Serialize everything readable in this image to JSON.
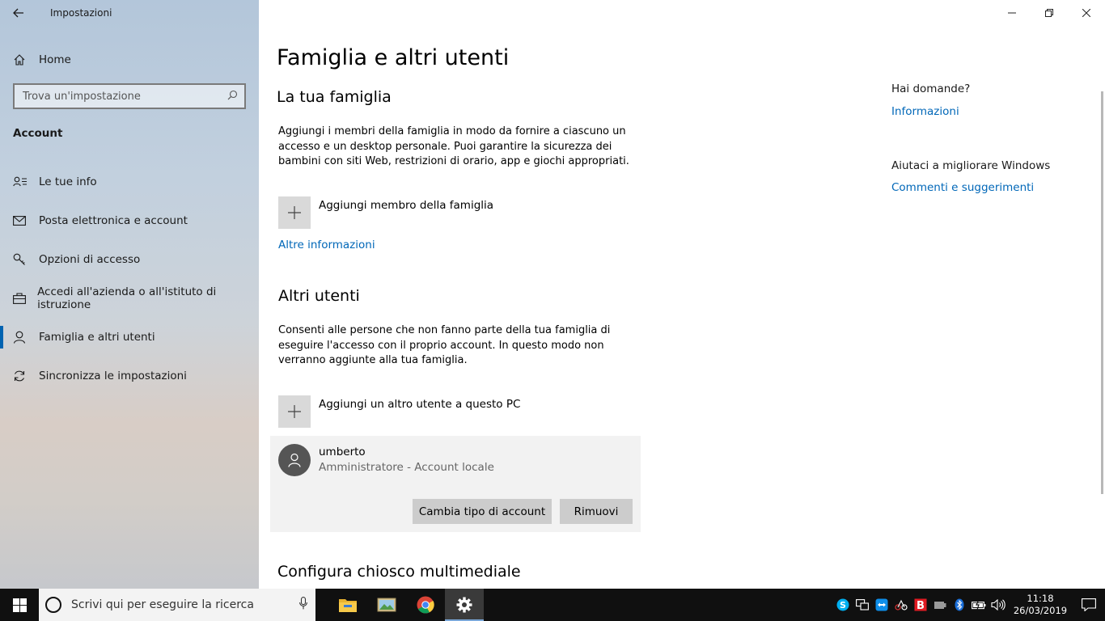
{
  "window": {
    "app_title": "Impostazioni",
    "controls": {
      "minimize": "—",
      "restore": "❐",
      "close": "✕"
    }
  },
  "sidebar": {
    "home_label": "Home",
    "search_placeholder": "Trova un'impostazione",
    "section": "Account",
    "items": [
      {
        "label": "Le tue info",
        "icon": "person-list-icon"
      },
      {
        "label": "Posta elettronica e account",
        "icon": "mail-icon"
      },
      {
        "label": "Opzioni di accesso",
        "icon": "key-icon"
      },
      {
        "label": "Accedi all'azienda o all'istituto di istruzione",
        "icon": "briefcase-icon"
      },
      {
        "label": "Famiglia e altri utenti",
        "icon": "person-icon",
        "active": true
      },
      {
        "label": "Sincronizza le impostazioni",
        "icon": "sync-icon"
      }
    ]
  },
  "main": {
    "title": "Famiglia e altri utenti",
    "family": {
      "heading": "La tua famiglia",
      "description": "Aggiungi i membri della famiglia in modo da fornire a ciascuno un accesso e un desktop personale. Puoi garantire la sicurezza dei bambini con siti Web, restrizioni di orario, app e giochi appropriati.",
      "add_label": "Aggiungi membro della famiglia",
      "more_info": "Altre informazioni"
    },
    "other_users": {
      "heading": "Altri utenti",
      "description": "Consenti alle persone che non fanno parte della tua famiglia di eseguire l'accesso con il proprio account. In questo modo non verranno aggiunte alla tua famiglia.",
      "add_label": "Aggiungi un altro utente a questo PC",
      "user": {
        "name": "umberto",
        "role": "Amministratore - Account locale",
        "change_type_button": "Cambia tipo di account",
        "remove_button": "Rimuovi"
      }
    },
    "kiosk_heading": "Configura chiosco multimediale"
  },
  "right_panel": {
    "questions_heading": "Hai domande?",
    "questions_link": "Informazioni",
    "improve_heading": "Aiutaci a migliorare Windows",
    "improve_link": "Commenti e suggerimenti"
  },
  "taskbar": {
    "search_placeholder": "Scrivi qui per eseguire la ricerca",
    "apps": [
      "file-explorer-icon",
      "photos-icon",
      "chrome-icon",
      "settings-icon"
    ],
    "tray_icons": [
      "skype-icon",
      "network-devices-icon",
      "teamviewer-icon",
      "tool-icon",
      "antivirus-icon",
      "usb-icon",
      "bluetooth-icon",
      "battery-icon",
      "volume-icon"
    ],
    "time": "11:18",
    "date": "26/03/2019",
    "colors": {
      "accent": "#0067b8",
      "taskbar_bg": "#101010"
    }
  }
}
